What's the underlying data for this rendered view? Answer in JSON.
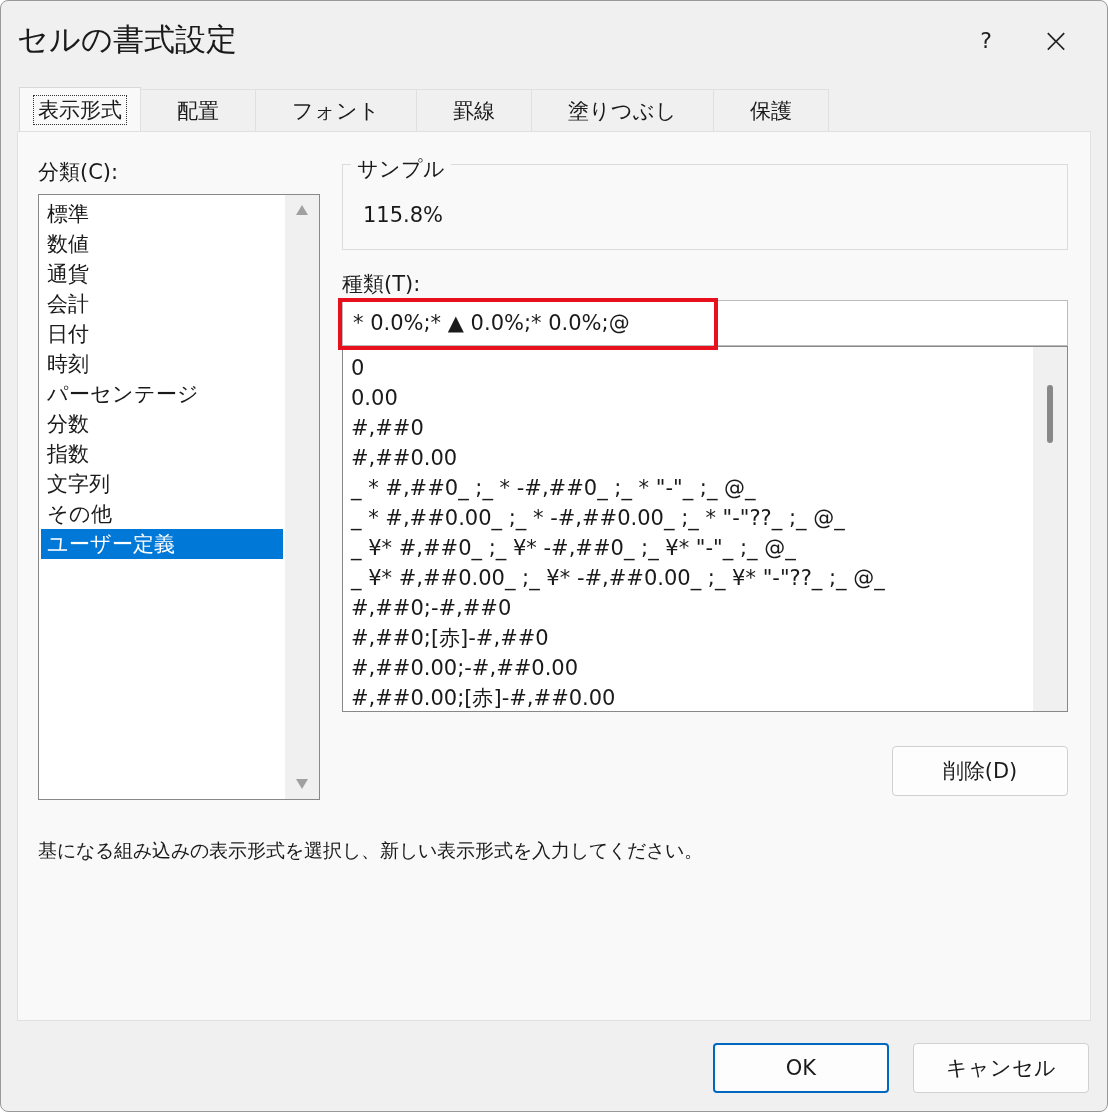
{
  "window": {
    "title": "セルの書式設定",
    "help": "?",
    "close": "×"
  },
  "tabs": [
    {
      "label": "表示形式",
      "selected": true
    },
    {
      "label": "配置",
      "selected": false
    },
    {
      "label": "フォント",
      "selected": false
    },
    {
      "label": "罫線",
      "selected": false
    },
    {
      "label": "塗りつぶし",
      "selected": false
    },
    {
      "label": "保護",
      "selected": false
    }
  ],
  "category": {
    "label": "分類(C):",
    "items": [
      {
        "label": "標準",
        "selected": false
      },
      {
        "label": "数値",
        "selected": false
      },
      {
        "label": "通貨",
        "selected": false
      },
      {
        "label": "会計",
        "selected": false
      },
      {
        "label": "日付",
        "selected": false
      },
      {
        "label": "時刻",
        "selected": false
      },
      {
        "label": "パーセンテージ",
        "selected": false
      },
      {
        "label": "分数",
        "selected": false
      },
      {
        "label": "指数",
        "selected": false
      },
      {
        "label": "文字列",
        "selected": false
      },
      {
        "label": "その他",
        "selected": false
      },
      {
        "label": "ユーザー定義",
        "selected": true
      }
    ]
  },
  "sample": {
    "label": "サンプル",
    "value": "115.8%"
  },
  "type": {
    "label": "種類(T):",
    "value": "* 0.0%;* ▲ 0.0%;* 0.0%;@",
    "highlighted": true,
    "items": [
      "0",
      "0.00",
      "#,##0",
      "#,##0.00",
      "_ * #,##0_ ;_ * -#,##0_ ;_ * \"-\"_ ;_ @_",
      "_ * #,##0.00_ ;_ * -#,##0.00_ ;_ * \"-\"??_ ;_ @_",
      "_ ¥* #,##0_ ;_ ¥* -#,##0_ ;_ ¥* \"-\"_ ;_ @_",
      "_ ¥* #,##0.00_ ;_ ¥* -#,##0.00_ ;_ ¥* \"-\"??_ ;_ @_",
      "#,##0;-#,##0",
      "#,##0;[赤]-#,##0",
      "#,##0.00;-#,##0.00",
      "#,##0.00;[赤]-#,##0.00"
    ]
  },
  "delete_button": "削除(D)",
  "description": "基になる組み込みの表示形式を選択し、新しい表示形式を入力してください。",
  "buttons": [
    {
      "label": "OK",
      "kind": "default"
    },
    {
      "label": "キャンセル",
      "kind": "normal"
    }
  ]
}
